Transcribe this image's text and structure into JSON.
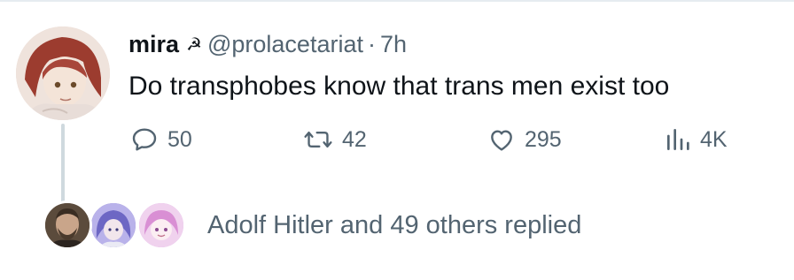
{
  "author": {
    "display_name": "mira",
    "emoji": "☭",
    "handle": "@prolacetariat",
    "separator": "·",
    "time": "7h"
  },
  "tweet": {
    "text": "Do transphobes know that trans men exist too"
  },
  "actions": {
    "replies": "50",
    "reposts": "42",
    "likes": "295",
    "views": "4K"
  },
  "replied": {
    "text": "Adolf Hitler and 49 others replied"
  },
  "colors": {
    "text_primary": "#0f1419",
    "text_secondary": "#536471",
    "thread_line": "#cfd9de"
  },
  "icons": [
    "reply-icon",
    "repost-icon",
    "like-icon",
    "views-icon"
  ]
}
